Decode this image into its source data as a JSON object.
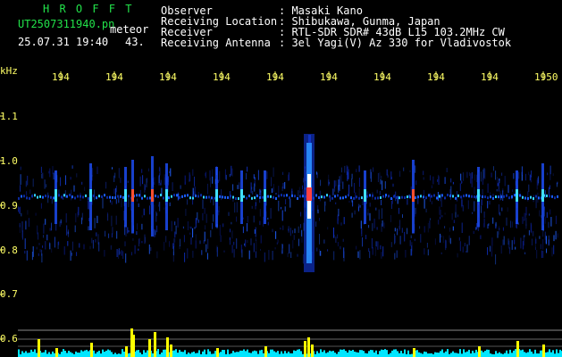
{
  "header": {
    "app_name": "H R O F F T",
    "filename": "UT2507311940.pn",
    "meteor_label": "meteor",
    "datetime": "25.07.31 19:40",
    "count": "43.",
    "fields": [
      {
        "label": "Observer",
        "value": ": Masaki Kano"
      },
      {
        "label": "Receiving Location",
        "value": ": Shibukawa, Gunma, Japan"
      },
      {
        "label": "Receiver",
        "value": ": RTL-SDR SDR# 43dB L15 103.2MHz CW"
      },
      {
        "label": "Receiving Antenna",
        "value": ": 3el Yagi(V) Az 330 for Vladivostok"
      }
    ]
  },
  "chart_data": {
    "type": "heatmap",
    "ylabel": "kHz",
    "yticks": [
      "1.1",
      "1.0",
      "0.9",
      "0.8",
      "0.7",
      "0.6"
    ],
    "xticks": [
      "194",
      "194",
      "194",
      "194",
      "194",
      "194",
      "194",
      "194",
      "194",
      "1950"
    ],
    "colors": {
      "label": "#ffff66",
      "baseline": "#00e6ff",
      "bars": "#ffff00",
      "signal": "#ffffff"
    }
  }
}
